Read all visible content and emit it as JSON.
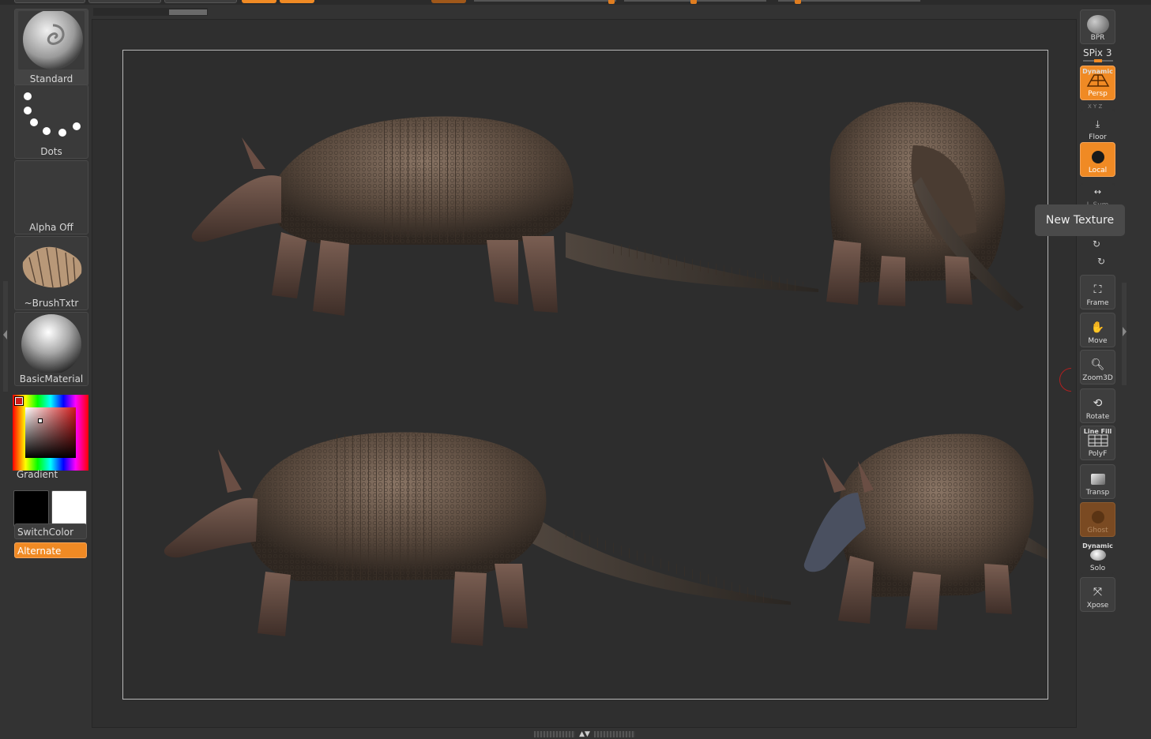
{
  "brush_shelf": {
    "brush_label": "Standard",
    "stroke_label": "Dots",
    "alpha_label": "Alpha Off",
    "texture_label": "~BrushTxtr",
    "material_label": "BasicMaterial",
    "gradient_label": "Gradient",
    "switchcolor_label": "SwitchColor",
    "alternate_label": "Alternate"
  },
  "colors": {
    "main_color": "#d01a1a",
    "primary_swatch": "#000000",
    "secondary_swatch": "#ffffff",
    "accent": "#f08a24"
  },
  "right_shelf": {
    "bpr_label": "BPR",
    "spix_label": "SPix 3",
    "persp_top": "Dynamic",
    "persp_label": "Persp",
    "xyz_label": "X Y Z",
    "floor_label": "Floor",
    "local_label": "Local",
    "lsym_label": "L.Sym",
    "frame_label": "Frame",
    "move_label": "Move",
    "zoom_label": "Zoom3D",
    "rotate_label": "Rotate",
    "polyf_top": "Line Fill",
    "polyf_label": "PolyF",
    "transp_label": "Transp",
    "ghost_label": "Ghost",
    "solo_top": "Dynamic",
    "solo_label": "Solo",
    "xpose_label": "Xpose"
  },
  "tooltip": {
    "text": "New Texture"
  },
  "canvas": {
    "image_subject": "four armadillo renders (side, rear, side, three-quarter)"
  }
}
